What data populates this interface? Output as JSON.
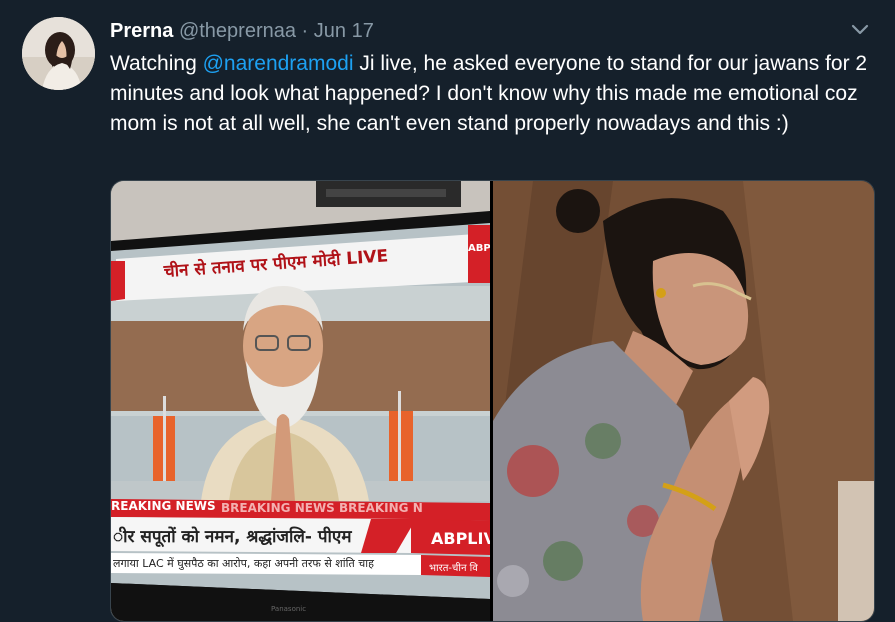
{
  "tweet": {
    "display_name": "Prerna",
    "handle": "@theprernaa",
    "separator": "·",
    "date": "Jun 17",
    "text_before": "Watching ",
    "mention": "@narendramodi",
    "text_after": " Ji live, he asked everyone to stand for our jawans for 2 minutes and look what happened? I don't know why this made me emotional coz mom is not at all well, she can't even stand properly nowadays and this :)"
  },
  "icons": {
    "menu": "chevron-down-icon",
    "avatar": "avatar"
  },
  "media": {
    "tv_overlay": {
      "channel_logo": "ABP",
      "headline": "चीन से तनाव पर पीएम मोदी LIVE",
      "breaking_label": "REAKING NEWS",
      "breaking_repeat": "BREAKING NEWS BREAKING N",
      "ticker": "ीर सपूतों को नमन, श्रद्धांजलि- पीएम",
      "live_tag": "ABPLIV",
      "bottom_ticker": "लगाया LAC में घुसपैठ का आरोप, कहा अपनी तरफ से शांति चाह",
      "bottom_tag": "भारत-चीन वि",
      "tv_brand": "Panasonic"
    }
  },
  "colors": {
    "background": "#15202b",
    "text_primary": "#ffffff",
    "text_secondary": "#8899a6",
    "link": "#1da1f2",
    "border": "#38444d",
    "news_red": "#d42027"
  }
}
